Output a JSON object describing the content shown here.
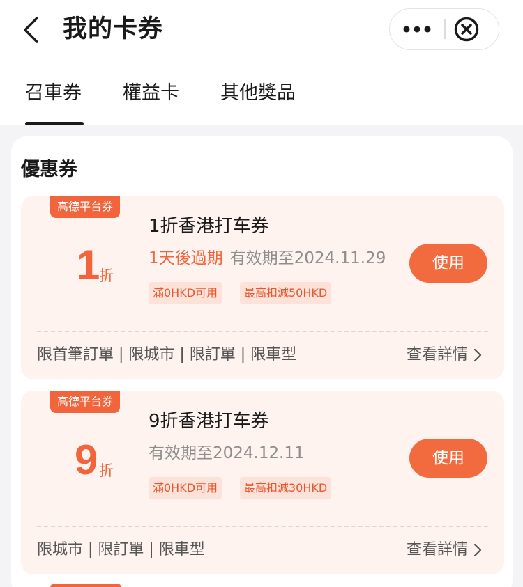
{
  "header": {
    "title": "我的卡券",
    "back_icon": "chevron-left-icon",
    "more_icon": "more-dots-icon",
    "close_icon": "close-circle-icon"
  },
  "tabs": [
    {
      "label": "召車券",
      "active": true
    },
    {
      "label": "權益卡",
      "active": false
    },
    {
      "label": "其他獎品",
      "active": false
    }
  ],
  "section": {
    "title": "優惠券"
  },
  "coupons": [
    {
      "badge": "高德平台券",
      "discount": "1",
      "unit": "折",
      "name": "1折香港打车券",
      "expire_warning": "1天後過期",
      "validity": "有效期至2024.11.29",
      "tags": [
        "滿0HKD可用",
        "最高扣減50HKD"
      ],
      "button": "使用",
      "limits": "限首筆訂單 | 限城市 | 限訂單 | 限車型",
      "details": "查看詳情"
    },
    {
      "badge": "高德平台券",
      "discount": "9",
      "unit": "折",
      "name": "9折香港打车券",
      "expire_warning": "",
      "validity": "有效期至2024.12.11",
      "tags": [
        "滿0HKD可用",
        "最高扣減30HKD"
      ],
      "button": "使用",
      "limits": "限城市 | 限訂單 | 限車型",
      "details": "查看詳情"
    }
  ],
  "colors": {
    "accent": "#f2643b",
    "card_bg": "#fff3f0",
    "tag_bg": "#fde2da"
  }
}
